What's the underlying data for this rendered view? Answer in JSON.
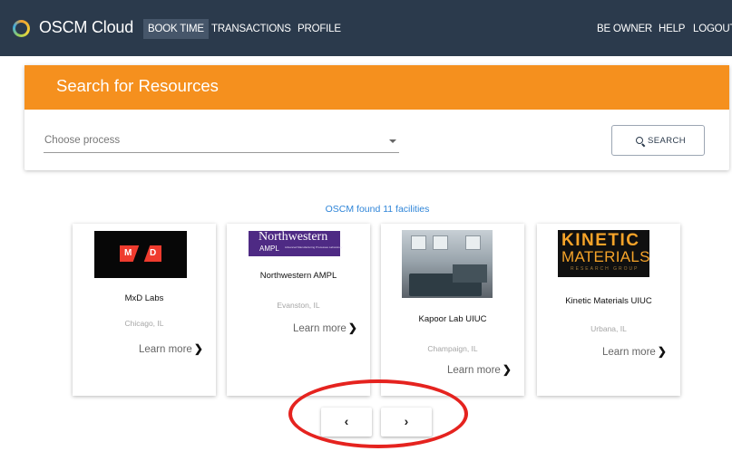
{
  "nav": {
    "brand": "OSCM Cloud",
    "left_items": [
      "BOOK TIME",
      "TRANSACTIONS",
      "PROFILE"
    ],
    "active_item": "BOOK TIME",
    "right_items": [
      "BE OWNER",
      "HELP",
      "LOGOUT"
    ]
  },
  "search": {
    "title": "Search for Resources",
    "process_placeholder": "Choose process",
    "button_label": "SEARCH"
  },
  "results": {
    "summary": "OSCM found 11 facilities",
    "learn_more": "Learn more",
    "facilities": [
      {
        "name": "MxD Labs",
        "location": "Chicago, IL",
        "logo_text": "MXD"
      },
      {
        "name": "Northwestern AMPL",
        "location": "Evanston, IL",
        "logo_text": "Northwestern",
        "logo_subtext": "AMPL",
        "logo_tagline": "Advanced Manufacturing Processes Laboratory"
      },
      {
        "name": "Kapoor Lab UIUC",
        "location": "Champaign, IL"
      },
      {
        "name": "Kinetic Materials UIUC",
        "location": "Urbana, IL",
        "logo_text": "KINETIC",
        "logo_subtext": "MATERIALS",
        "logo_tagline": "RESEARCH GROUP"
      }
    ]
  },
  "pager": {
    "prev": "‹",
    "next": "›"
  },
  "colors": {
    "nav_bg": "#2b3a4c",
    "header_orange": "#f5901e",
    "link_blue": "#2f85d8",
    "annotation_red": "#e5231f"
  }
}
